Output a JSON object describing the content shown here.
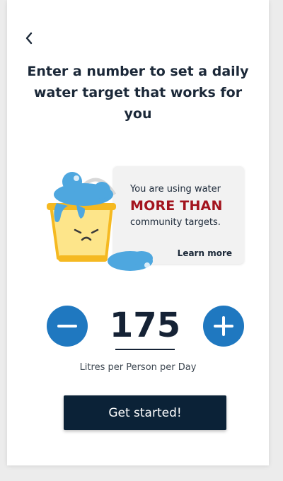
{
  "header": {
    "back_icon": "chevron-left-icon",
    "title": "Enter a number to set a daily water target that works for you"
  },
  "notice": {
    "line1": "You are using water",
    "emphasis": "MORE THAN",
    "line2": "community targets.",
    "link": "Learn more"
  },
  "target": {
    "value": "175",
    "unit": "Litres per Person per Day",
    "decrease_icon": "minus-icon",
    "increase_icon": "plus-icon"
  },
  "cta": {
    "label": "Get started!"
  },
  "colors": {
    "primary_blue": "#1f78c0",
    "navy": "#0b2237",
    "alert_red": "#a3141e",
    "bucket_yellow": "#fcd94f",
    "water_blue": "#4ea7df"
  }
}
